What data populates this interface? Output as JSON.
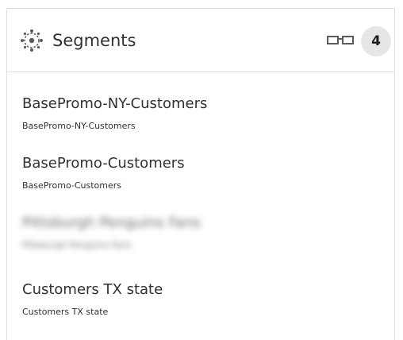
{
  "panel": {
    "title": "Segments",
    "count": "4",
    "header_icon": "segments-icon",
    "view_icon": "glasses-icon"
  },
  "segments": [
    {
      "name": "BasePromo-NY-Customers",
      "subtitle": "BasePromo-NY-Customers"
    },
    {
      "name": "BasePromo-Customers",
      "subtitle": "BasePromo-Customers"
    },
    {
      "name": "Pittsburgh Penguins Fans",
      "subtitle": "Pittsburgh Penguins Fans"
    },
    {
      "name": "Customers TX state",
      "subtitle": "Customers TX state"
    }
  ],
  "colors": {
    "text": "#323130",
    "divider": "#e1dfdd",
    "badge_bg": "#e6e6e6"
  }
}
